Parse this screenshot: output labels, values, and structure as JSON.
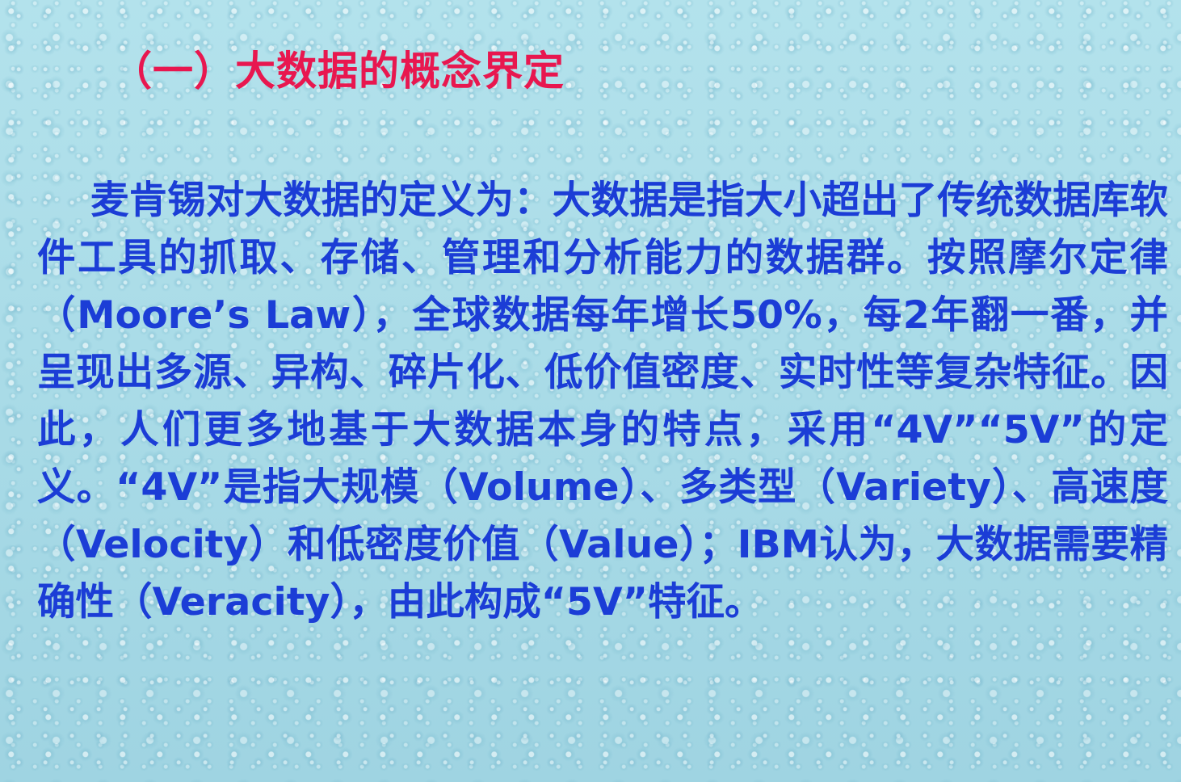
{
  "slide": {
    "title": "（一）大数据的概念界定",
    "body": "麦肯锡对大数据的定义为：大数据是指大小超出了传统数据库软件工具的抓取、存储、管理和分析能力的数据群。按照摩尔定律（Moore’s Law），全球数据每年增长50%，每2年翻一番，并呈现出多源、异构、碎片化、低价值密度、实时性等复杂特征。因此，人们更多地基于大数据本身的特点，采用“4V”“5V”的定义。“4V”是指大规模（Volume）、多类型（Variety）、高速度（Velocity）和低密度价值（Value）；IBM认为，大数据需要精确性（Veracity），由此构成“5V”特征。",
    "title_color": "#e8174f",
    "text_color": "#1b3dd6",
    "background_color": "#a9dbe6"
  }
}
